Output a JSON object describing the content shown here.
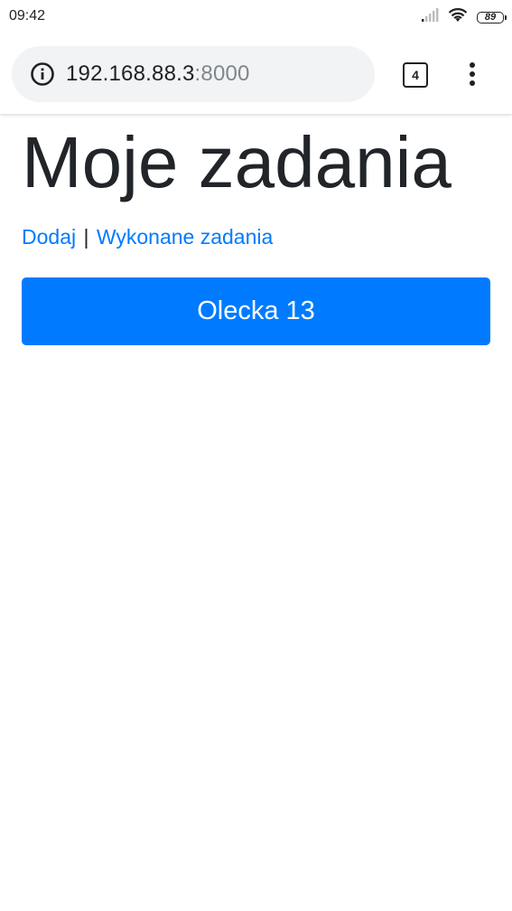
{
  "status_bar": {
    "time": "09:42",
    "battery_level": "89",
    "icons": [
      "signal-icon",
      "wifi-icon",
      "battery-icon"
    ]
  },
  "browser": {
    "url_host": "192.168.88.3",
    "url_port": ":8000",
    "tab_count": "4",
    "icons": [
      "info-icon",
      "tabs-icon",
      "overflow-menu-icon"
    ]
  },
  "page": {
    "title": "Moje zadania",
    "links": {
      "add": "Dodaj",
      "separator": "|",
      "completed": "Wykonane zadania"
    },
    "tasks": [
      {
        "label": "Olecka 13"
      }
    ]
  },
  "colors": {
    "primary": "#007bff",
    "text": "#212529",
    "omnibox_bg": "#f1f3f4"
  }
}
